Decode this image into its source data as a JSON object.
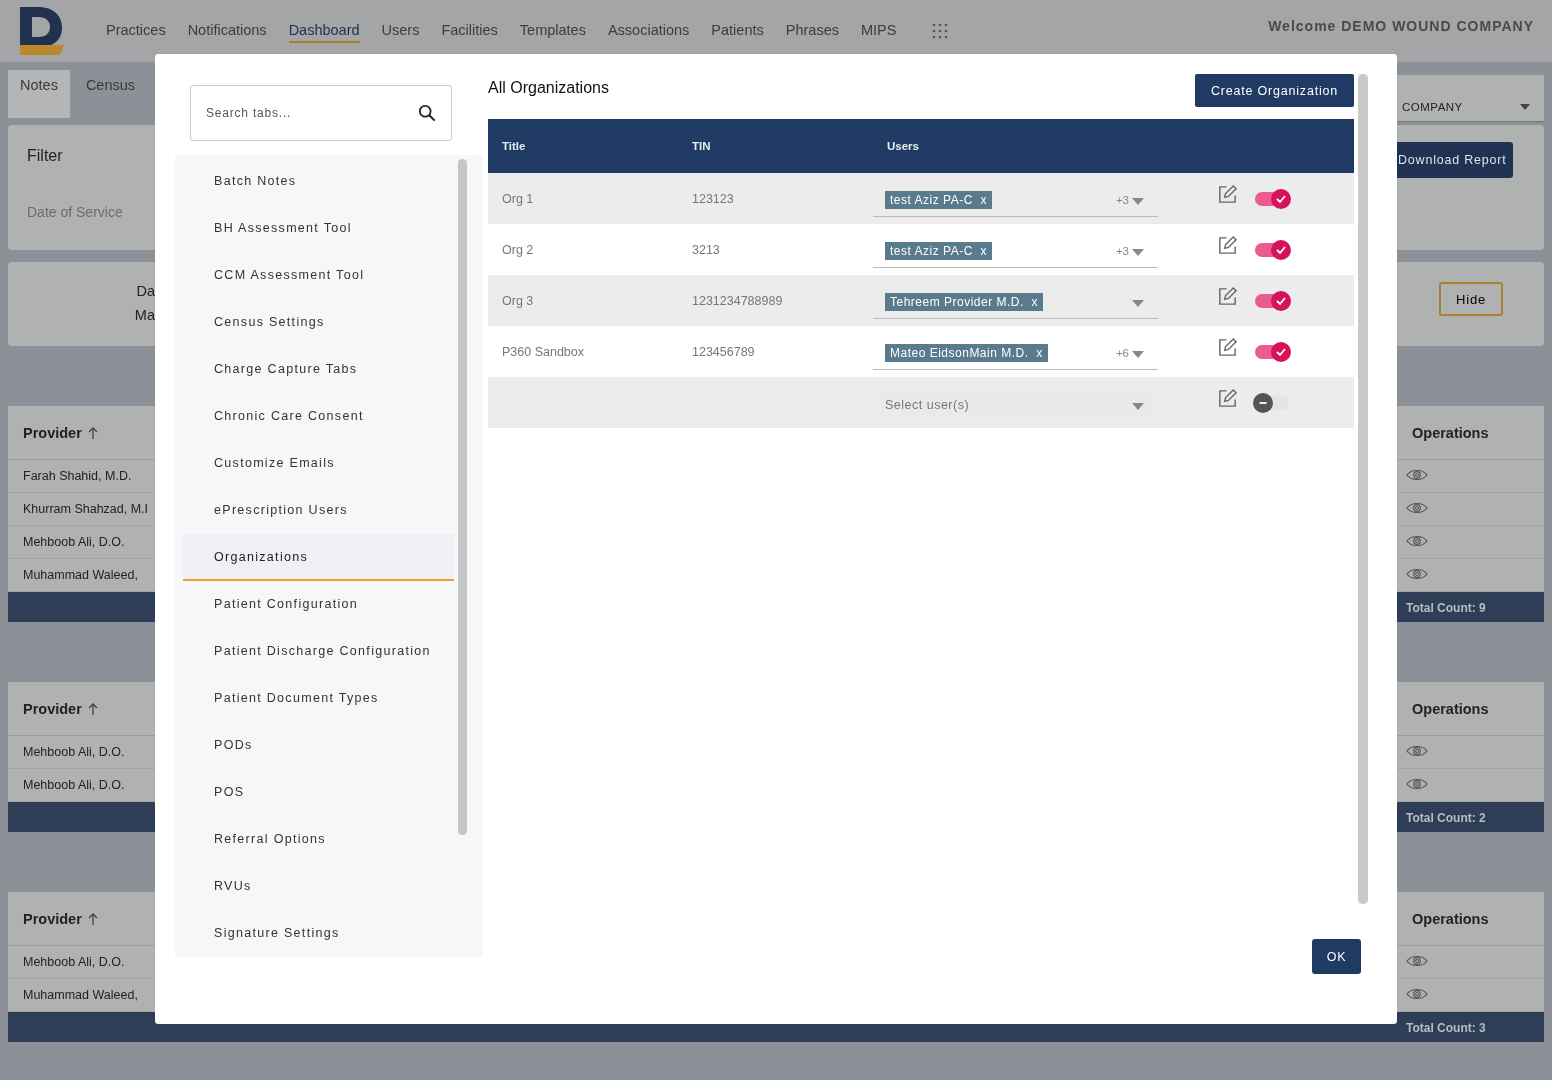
{
  "header": {
    "welcome": "Welcome DEMO WOUND COMPANY",
    "nav": [
      {
        "label": "Practices",
        "selected": false
      },
      {
        "label": "Notifications",
        "selected": false
      },
      {
        "label": "Dashboard",
        "selected": true
      },
      {
        "label": "Users",
        "selected": false
      },
      {
        "label": "Facilities",
        "selected": false
      },
      {
        "label": "Templates",
        "selected": false
      },
      {
        "label": "Associations",
        "selected": false
      },
      {
        "label": "Patients",
        "selected": false
      },
      {
        "label": "Phrases",
        "selected": false
      },
      {
        "label": "MIPS",
        "selected": false
      }
    ]
  },
  "page_tabs": [
    {
      "label": "Notes",
      "selected": true
    },
    {
      "label": "Census",
      "selected": false
    }
  ],
  "company_select": {
    "value": "COMPANY"
  },
  "filter": {
    "title": "Filter",
    "date_label": "Date of Service",
    "download_button": "Download Report"
  },
  "summary": {
    "lines": [
      "Da",
      "Ma"
    ],
    "hide_button": "Hide"
  },
  "tables": [
    {
      "provider_header": "Provider",
      "operations_header": "Operations",
      "rows": [
        "Farah Shahid, M.D.",
        "Khurram Shahzad, M.I",
        "Mehboob Ali, D.O.",
        "Muhammad Waleed,"
      ],
      "total": "Total Count: 9"
    },
    {
      "provider_header": "Provider",
      "operations_header": "Operations",
      "rows": [
        "Mehboob Ali, D.O.",
        "Mehboob Ali, D.O."
      ],
      "total": "Total Count: 2"
    },
    {
      "provider_header": "Provider",
      "operations_header": "Operations",
      "rows": [
        "Mehboob Ali, D.O.",
        "Muhammad Waleed,"
      ],
      "total": "Total Count: 3"
    }
  ],
  "modal": {
    "search": {
      "placeholder": "Search tabs..."
    },
    "tabs": [
      {
        "label": "Batch Notes",
        "selected": false
      },
      {
        "label": "BH Assessment Tool",
        "selected": false
      },
      {
        "label": "CCM Assessment Tool",
        "selected": false
      },
      {
        "label": "Census Settings",
        "selected": false
      },
      {
        "label": "Charge Capture Tabs",
        "selected": false
      },
      {
        "label": "Chronic Care Consent",
        "selected": false
      },
      {
        "label": "Customize Emails",
        "selected": false
      },
      {
        "label": "ePrescription Users",
        "selected": false
      },
      {
        "label": "Organizations",
        "selected": true
      },
      {
        "label": "Patient Configuration",
        "selected": false
      },
      {
        "label": "Patient Discharge Configuration",
        "selected": false
      },
      {
        "label": "Patient Document Types",
        "selected": false
      },
      {
        "label": "PODs",
        "selected": false
      },
      {
        "label": "POS",
        "selected": false
      },
      {
        "label": "Referral Options",
        "selected": false
      },
      {
        "label": "RVUs",
        "selected": false
      },
      {
        "label": "Signature Settings",
        "selected": false
      }
    ],
    "title": "All Organizations",
    "create_button": "Create Organization",
    "columns": [
      "Title",
      "TIN",
      "Users"
    ],
    "rows": [
      {
        "kind": "org",
        "title": "Org 1",
        "tin": "123123",
        "user": "test Aziz PA-C",
        "remove": "x",
        "more": "+3",
        "active": true
      },
      {
        "kind": "org",
        "title": "Org 2",
        "tin": "3213",
        "user": "test Aziz PA-C",
        "remove": "x",
        "more": "+3",
        "active": true
      },
      {
        "kind": "org",
        "title": "Org 3",
        "tin": "1231234788989",
        "user": "Tehreem Provider M.D.",
        "remove": "x",
        "active": true
      },
      {
        "kind": "org",
        "title": "P360 Sandbox",
        "tin": "123456789",
        "user": "Mateo EidsonMain M.D.",
        "remove": "x",
        "more": "+6",
        "active": true
      },
      {
        "kind": "new",
        "placeholder": "Select user(s)",
        "active": false
      }
    ],
    "ok_button": "OK"
  }
}
